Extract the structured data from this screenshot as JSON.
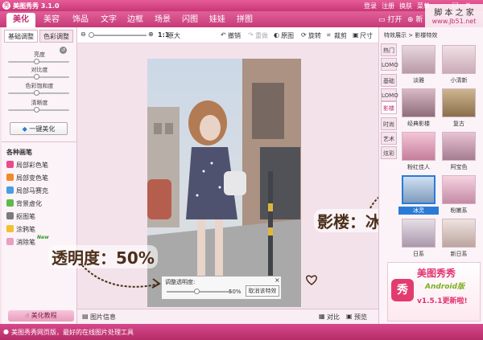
{
  "titlebar": {
    "title": "美图秀秀 3.1.0",
    "login": "登录",
    "register": "注册",
    "skin": "换肤",
    "menu": "菜单"
  },
  "tabs": [
    "美化",
    "美容",
    "饰品",
    "文字",
    "边框",
    "场景",
    "闪图",
    "娃娃",
    "拼图"
  ],
  "active_tab": 0,
  "header_right": {
    "open": "打开",
    "new": "新"
  },
  "watermark": {
    "site": "脚 本 之 家",
    "url": "www.Jb51.net"
  },
  "left": {
    "subtabs": [
      "基础调整",
      "色彩调整"
    ],
    "sliders": [
      {
        "label": "亮度",
        "level": 0.5
      },
      {
        "label": "对比度",
        "level": 0.5
      },
      {
        "label": "色彩饱和度",
        "level": 0.5
      },
      {
        "label": "清晰度",
        "level": 0.5
      }
    ],
    "one_click": "一键美化",
    "pens_title": "各种画笔",
    "pens": [
      "局部彩色笔",
      "局部变色笔",
      "局部马赛克",
      "背景虚化",
      "抠图笔",
      "涂鸦笔",
      "消除笔"
    ],
    "new_badge": "New",
    "tutorial": "美化教程"
  },
  "toolbar": {
    "zoom_ratio": "1:1",
    "original_size": "原大",
    "undo": "撤销",
    "redo": "重做",
    "original": "原图",
    "rotate": "旋转",
    "crop": "裁剪",
    "resize": "尺寸"
  },
  "bottom": {
    "info": "图片信息",
    "compare": "对比",
    "preview": "预览"
  },
  "dialog": {
    "title": "调整透明度:",
    "value": "50%",
    "level": 0.5,
    "cancel": "取消该特效"
  },
  "right": {
    "header": "特效展示 > 影楼特效",
    "vtabs": [
      "热门",
      "LOMO",
      "基础",
      "LOMO",
      "影楼",
      "时尚",
      "艺术",
      "炫彩"
    ],
    "active_vtab": 4,
    "effects": [
      "淡雅",
      "小清新",
      "经典影楼",
      "复古",
      "粉红佳人",
      "阿宝色",
      "冰灵",
      "粉嫩系",
      "日系",
      "新日系"
    ],
    "selected_effect": 6,
    "ad": {
      "title": "美图秀秀",
      "subtitle": "Android版",
      "version": "v1.5.1更新啦!"
    }
  },
  "annotations": {
    "opacity": "透明度：50%",
    "effect": "影楼：冰灵"
  },
  "status": {
    "text": "美图秀秀网页版，最好的在线图片处理工具"
  },
  "colors": {
    "brand": "#d23a7d",
    "panel": "#fbf3f7",
    "selected": "#2b7bd6"
  }
}
